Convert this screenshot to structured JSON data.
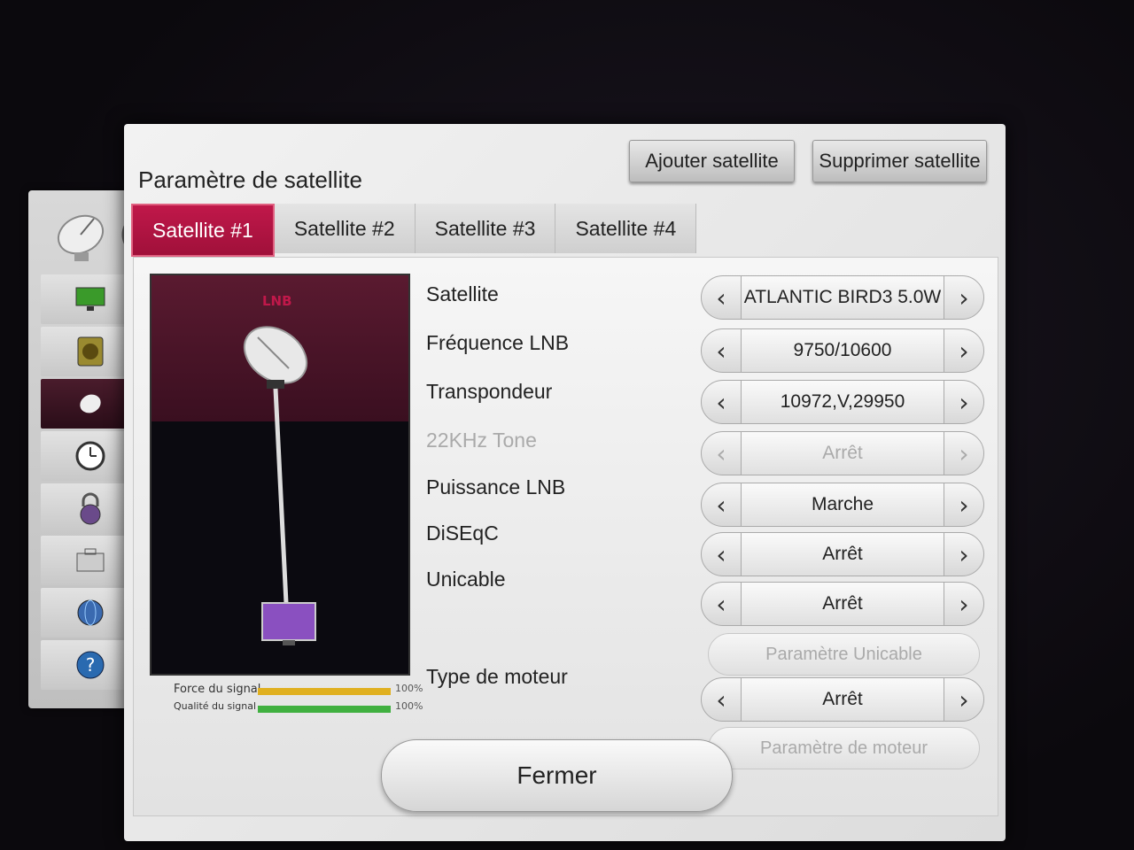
{
  "dialog": {
    "title": "Paramètre de satellite",
    "add_button": "Ajouter satellite",
    "delete_button": "Supprimer satellite",
    "close_button": "Fermer"
  },
  "tabs": [
    {
      "label": "Satellite #1",
      "active": true
    },
    {
      "label": "Satellite #2",
      "active": false
    },
    {
      "label": "Satellite #3",
      "active": false
    },
    {
      "label": "Satellite #4",
      "active": false
    }
  ],
  "preview": {
    "lnb_label": "LNB"
  },
  "signal": {
    "strength_label": "Force du signal",
    "strength_value": "100%",
    "strength_color": "#e0b020",
    "strength_fill": 1.0,
    "quality_label": "Qualité du signal",
    "quality_value": "100%",
    "quality_color": "#40b040",
    "quality_fill": 1.0
  },
  "fields": {
    "satellite": {
      "label": "Satellite",
      "value": "ATLANTIC BIRD3 5.0W"
    },
    "lnb_frequency": {
      "label": "Fréquence LNB",
      "value": "9750/10600"
    },
    "transponder": {
      "label": "Transpondeur",
      "value": "10972,V,29950"
    },
    "tone_22khz": {
      "label": "22KHz Tone",
      "value": "Arrêt",
      "disabled": true
    },
    "lnb_power": {
      "label": "Puissance LNB",
      "value": "Marche"
    },
    "diseqc": {
      "label": "DiSEqC",
      "value": "Arrêt"
    },
    "unicable": {
      "label": "Unicable",
      "value": "Arrêt"
    },
    "unicable_settings": {
      "label": "Paramètre Unicable",
      "disabled": true
    },
    "motor_type": {
      "label": "Type de moteur",
      "value": "Arrêt"
    },
    "motor_settings": {
      "label": "Paramètre de moteur",
      "disabled": true
    }
  },
  "icons": {
    "arrow_left": "‹",
    "arrow_right": "›"
  },
  "colors": {
    "accent": "#c0184a"
  }
}
